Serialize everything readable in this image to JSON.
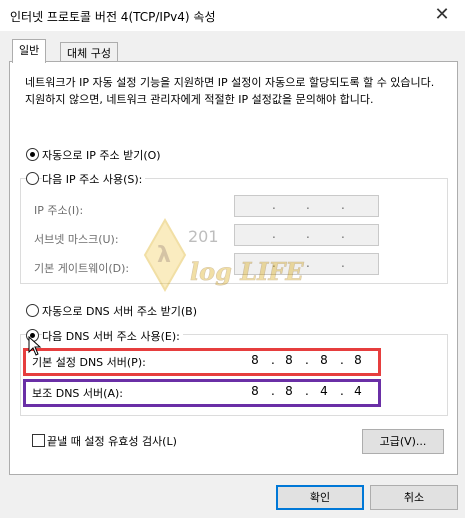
{
  "window": {
    "title": "인터넷 프로토콜 버전 4(TCP/IPv4) 속성",
    "close_glyph": "✕"
  },
  "tabs": [
    {
      "label": "일반"
    },
    {
      "label": "대체 구성"
    }
  ],
  "description": "네트워크가 IP 자동 설정 기능을 지원하면 IP 설정이 자동으로 할당되도록 할 수 있습니다. 지원하지 않으면, 네트워크 관리자에게 적절한 IP 설정값을 문의해야 합니다.",
  "ip_section": {
    "auto_label": "자동으로 IP 주소 받기(O)",
    "auto_selected": true,
    "manual_label": "다음 IP 주소 사용(S):",
    "manual_selected": false,
    "fields": [
      {
        "label": "IP 주소(I):",
        "octets": [
          "",
          "",
          "",
          ""
        ]
      },
      {
        "label": "서브넷 마스크(U):",
        "octets": [
          "",
          "",
          "",
          ""
        ]
      },
      {
        "label": "기본 게이트웨이(D):",
        "octets": [
          "",
          "",
          "",
          ""
        ]
      }
    ]
  },
  "dns_section": {
    "auto_label": "자동으로 DNS 서버 주소 받기(B)",
    "auto_selected": false,
    "manual_label": "다음 DNS 서버 주소 사용(E):",
    "manual_selected": true,
    "preferred": {
      "label": "기본 설정 DNS 서버(P):",
      "octets": [
        "8",
        "8",
        "8",
        "8"
      ]
    },
    "alternate": {
      "label": "보조 DNS 서버(A):",
      "octets": [
        "8",
        "8",
        "4",
        "4"
      ]
    }
  },
  "validate": {
    "label": "끝낼 때 설정 유효성 검사(L)",
    "checked": false
  },
  "buttons": {
    "advanced": "고급(V)...",
    "ok": "확인",
    "cancel": "취소"
  },
  "watermark": {
    "number": "201",
    "text": "log LIFE"
  },
  "colors": {
    "highlight_preferred": "#e63e3e",
    "highlight_alternate": "#6a2fa6",
    "focus_blue": "#0078d7"
  }
}
